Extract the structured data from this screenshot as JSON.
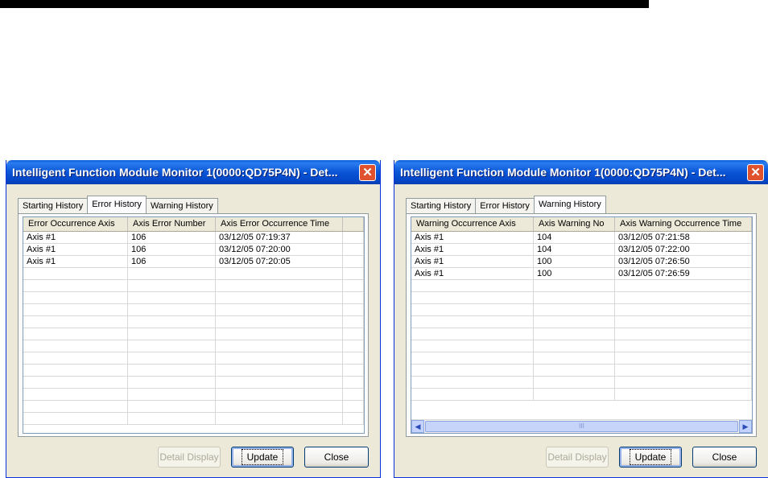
{
  "dialogs": [
    {
      "title": "Intelligent Function Module Monitor 1(0000:QD75P4N) - Det...",
      "close_glyph": "✕",
      "tabs": [
        "Starting History",
        "Error History",
        "Warning History"
      ],
      "active_tab": "Error History",
      "columns": [
        "Error Occurrence Axis",
        "Axis Error Number",
        "Axis Error Occurrence Time",
        ""
      ],
      "rows": [
        [
          "Axis #1",
          "106",
          "03/12/05 07:19:37"
        ],
        [
          "Axis #1",
          "106",
          "03/12/05 07:20:00"
        ],
        [
          "Axis #1",
          "106",
          "03/12/05 07:20:05"
        ]
      ],
      "buttons": {
        "detail": "Detail Display",
        "update": "Update",
        "close": "Close"
      }
    },
    {
      "title": "Intelligent Function Module Monitor 1(0000:QD75P4N) - Det...",
      "close_glyph": "✕",
      "tabs": [
        "Starting History",
        "Error History",
        "Warning History"
      ],
      "active_tab": "Warning History",
      "columns": [
        "Warning Occurrence Axis",
        "Axis Warning No",
        "Axis Warning Occurrence Time"
      ],
      "rows": [
        [
          "Axis #1",
          "104",
          "03/12/05 07:21:58"
        ],
        [
          "Axis #1",
          "104",
          "03/12/05 07:22:00"
        ],
        [
          "Axis #1",
          "100",
          "03/12/05 07:26:50"
        ],
        [
          "Axis #1",
          "100",
          "03/12/05 07:26:59"
        ]
      ],
      "scrollbar": {
        "left_icon": "◀",
        "right_icon": "▶",
        "grip": "III"
      },
      "buttons": {
        "detail": "Detail Display",
        "update": "Update",
        "close": "Close"
      }
    }
  ],
  "icons": {
    "close": "close-icon",
    "scroll_left": "scroll-left-icon",
    "scroll_right": "scroll-right-icon"
  },
  "colors": {
    "titlebar": "#0a55d6",
    "dialog_bg": "#ece9d8",
    "close_button": "#e0512d"
  }
}
